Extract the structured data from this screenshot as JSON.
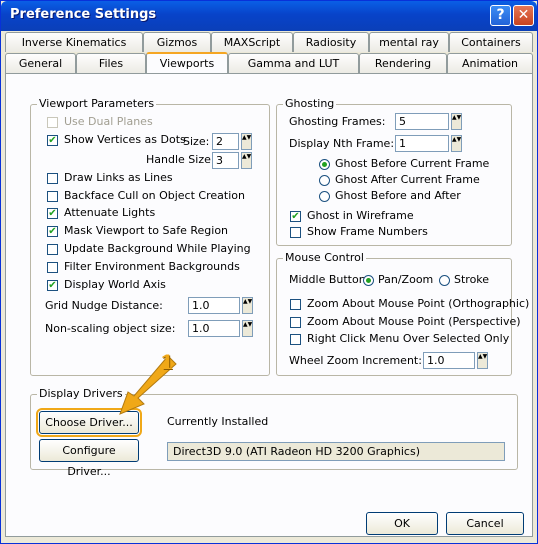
{
  "window": {
    "title": "Preference Settings",
    "help_glyph": "?",
    "close_glyph": "✕"
  },
  "tabs_row1": [
    "Inverse Kinematics",
    "Gizmos",
    "MAXScript",
    "Radiosity",
    "mental ray",
    "Containers"
  ],
  "tabs_row2": [
    "General",
    "Files",
    "Viewports",
    "Gamma and LUT",
    "Rendering",
    "Animation"
  ],
  "active_tab": "Viewports",
  "viewport_params": {
    "title": "Viewport Parameters",
    "use_dual_planes": "Use Dual Planes",
    "show_vertices": "Show Vertices as Dots",
    "size_label": "Size:",
    "size_value": "2",
    "handle_size_label": "Handle Size:",
    "handle_size_value": "3",
    "draw_links": "Draw Links as Lines",
    "backface": "Backface Cull on Object Creation",
    "attenuate": "Attenuate Lights",
    "mask": "Mask Viewport to Safe Region",
    "update_bg": "Update Background While Playing",
    "filter_env": "Filter Environment Backgrounds",
    "world_axis": "Display World Axis",
    "grid_nudge_label": "Grid Nudge Distance:",
    "grid_nudge_value": "1.0",
    "nonscaling_label": "Non-scaling object size:",
    "nonscaling_value": "1.0"
  },
  "ghosting": {
    "title": "Ghosting",
    "frames_label": "Ghosting Frames:",
    "frames_value": "5",
    "nth_label": "Display Nth Frame:",
    "nth_value": "1",
    "before": "Ghost Before Current Frame",
    "after": "Ghost After Current Frame",
    "both": "Ghost Before and After",
    "wireframe": "Ghost in Wireframe",
    "frame_numbers": "Show Frame Numbers"
  },
  "mouse": {
    "title": "Mouse Control",
    "middle_label": "Middle Button:",
    "panzoom": "Pan/Zoom",
    "stroke": "Stroke",
    "zoom_ortho": "Zoom About Mouse Point (Orthographic)",
    "zoom_persp": "Zoom About Mouse Point (Perspective)",
    "right_click": "Right Click Menu Over Selected Only",
    "wheel_label": "Wheel Zoom Increment:",
    "wheel_value": "1.0"
  },
  "drivers": {
    "title": "Display Drivers",
    "choose": "Choose Driver...",
    "configure": "Configure Driver...",
    "installed_label": "Currently Installed",
    "installed_value": "Direct3D 9.0 (ATI Radeon HD 3200 Graphics)"
  },
  "annotation": {
    "number": "1",
    "color": "#f0a818"
  },
  "buttons": {
    "ok": "OK",
    "cancel": "Cancel"
  },
  "check_glyph": "✔",
  "spin_glyph": "▲▼"
}
